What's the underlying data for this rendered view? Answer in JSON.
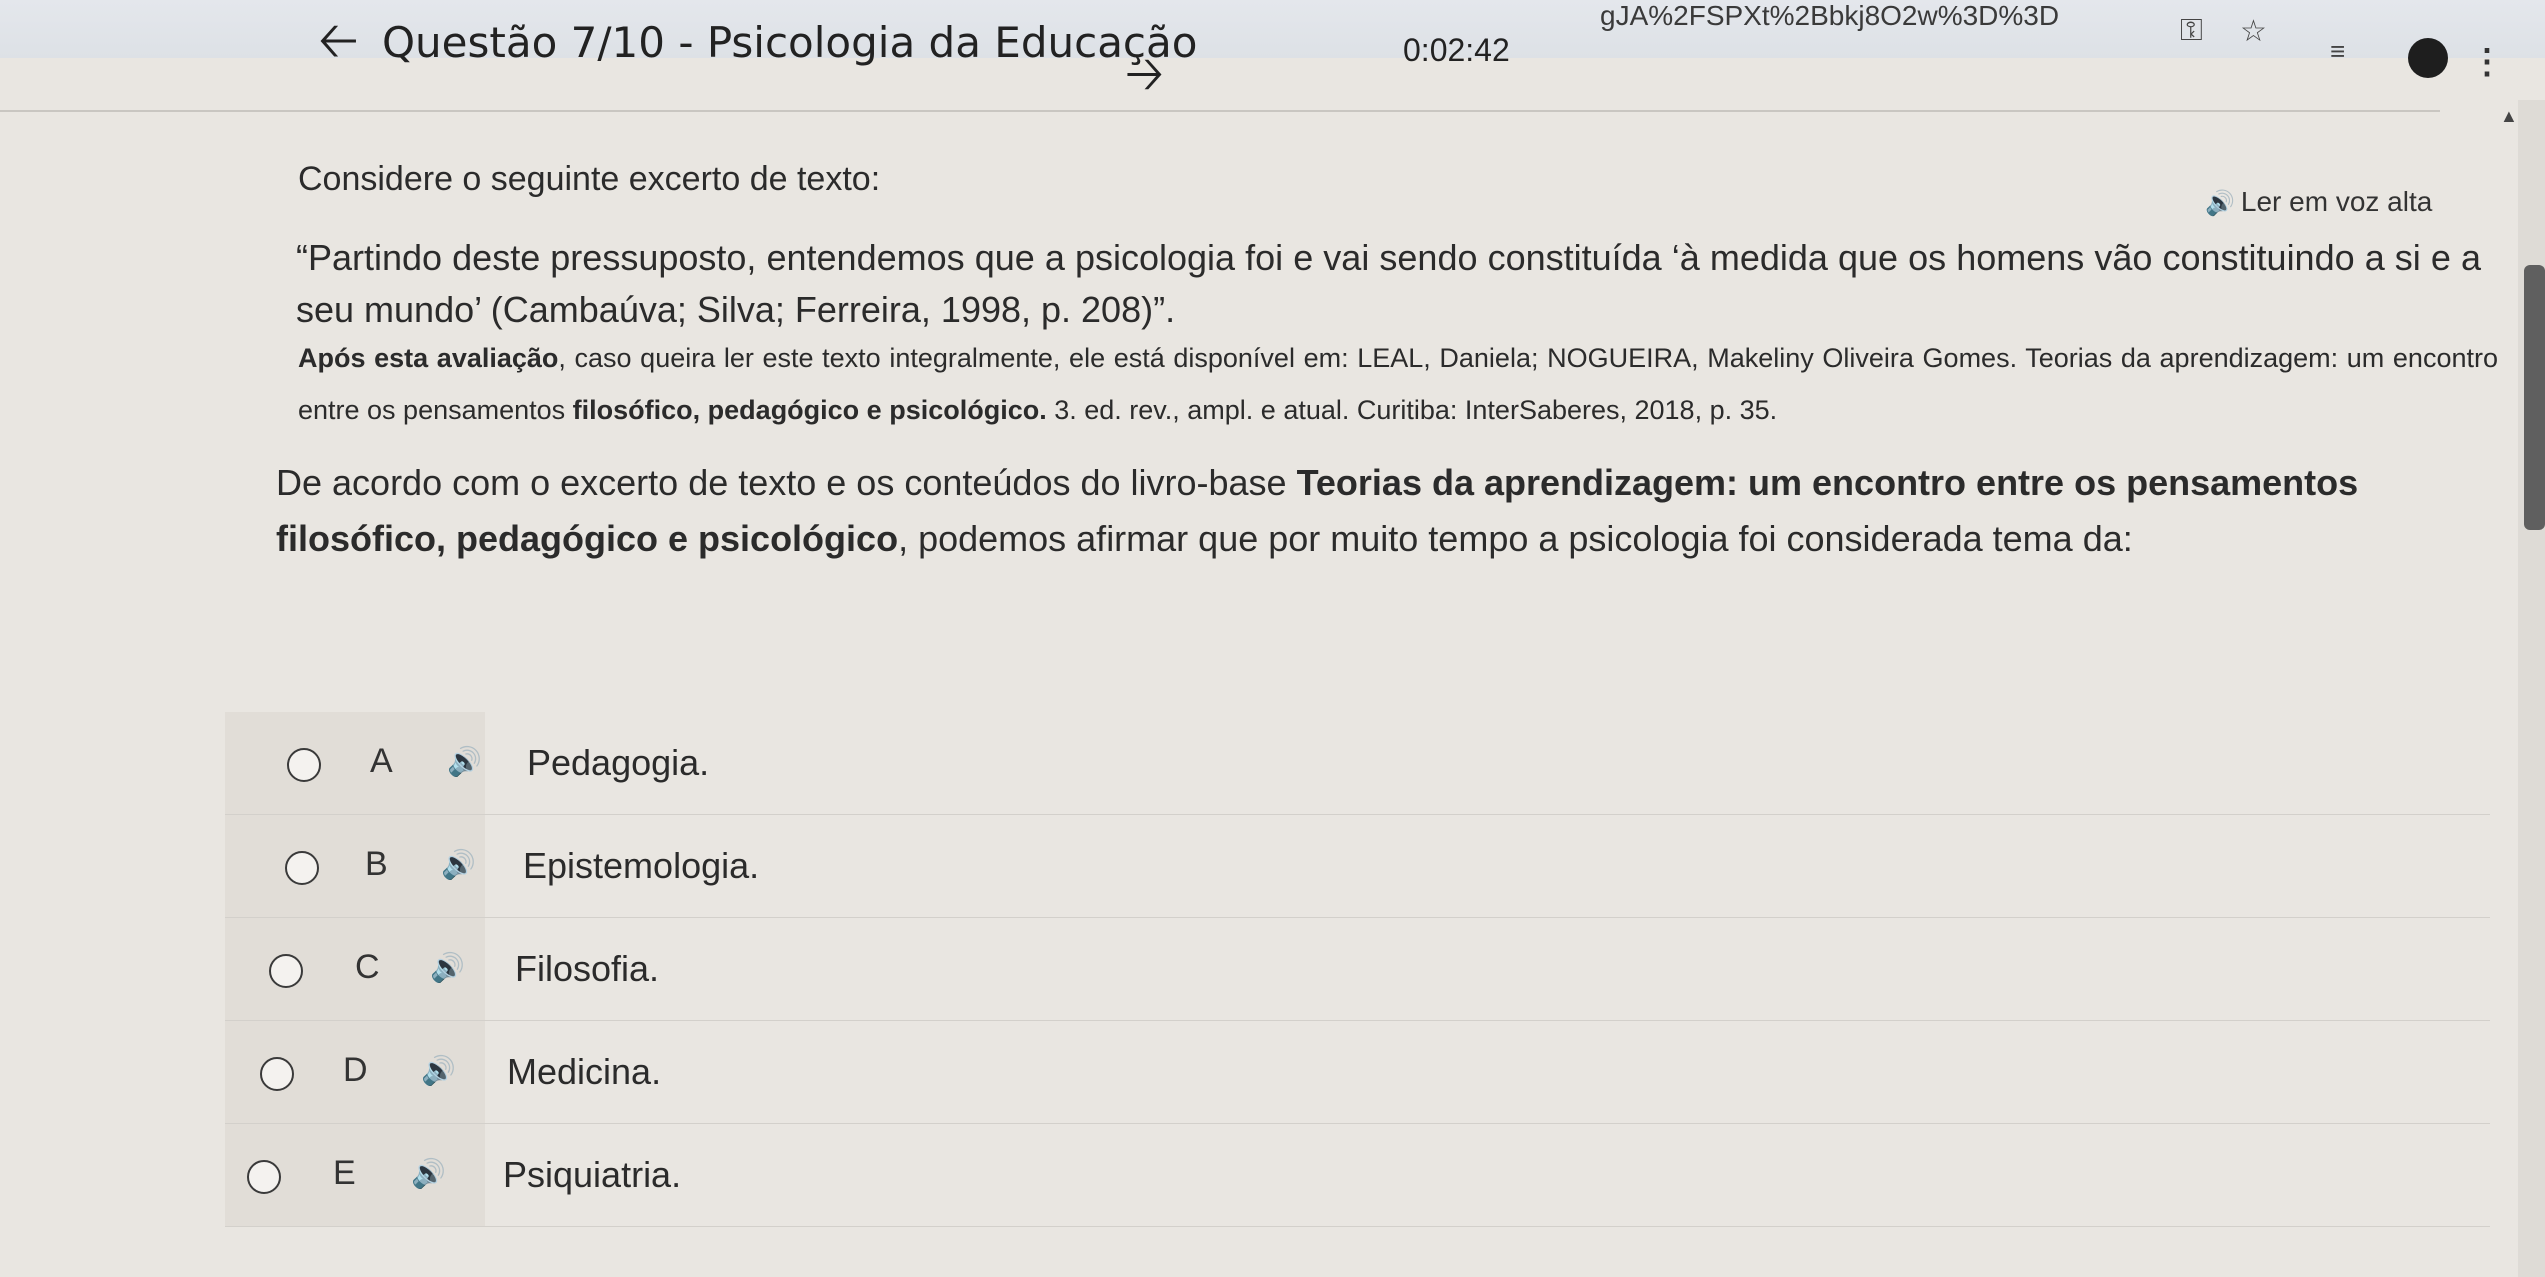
{
  "browser": {
    "url_fragment": "gJA%2FSPXt%2Bbkj8O2w%3D%3D",
    "icons": [
      "key-icon",
      "star-icon",
      "extensions-icon",
      "avatar",
      "menu-icon"
    ]
  },
  "header": {
    "title": "Questão 7/10 - Psicologia da Educação",
    "timer": "0:02:42"
  },
  "content": {
    "intro": "Considere o seguinte excerto de texto:",
    "read_aloud": "Ler em voz alta",
    "quote": "“Partindo deste pressuposto, entendemos que a psicologia foi e vai sendo constituída ‘à medida que os homens vão constituindo a si e a seu mundo’ (Cambaúva; Silva; Ferreira, 1998, p. 208)”.",
    "ref_bold_1": "Após esta avaliação",
    "ref_text_1": ", caso queira ler este texto integralmente, ele está disponível em: LEAL, Daniela; NOGUEIRA, Makeliny Oliveira Gomes. Teorias da aprendizagem: um encontro entre os pensamentos ",
    "ref_bold_2": "filosófico, pedagógico e psicológico.",
    "ref_text_2": " 3. ed. rev., ampl. e atual. Curitiba: InterSaberes, 2018, p. 35.",
    "question_1": "De acordo com o excerto de texto e os conteúdos do livro-base ",
    "question_bold": "Teorias da aprendizagem: um encontro entre os pensamentos filosófico, pedagógico e psicológico",
    "question_2": ", podemos afirmar que por muito tempo a psicologia foi considerada tema da:"
  },
  "options": [
    {
      "letter": "A",
      "text": "Pedagogia."
    },
    {
      "letter": "B",
      "text": "Epistemologia."
    },
    {
      "letter": "C",
      "text": "Filosofia."
    },
    {
      "letter": "D",
      "text": "Medicina."
    },
    {
      "letter": "E",
      "text": "Psiquiatria."
    }
  ]
}
